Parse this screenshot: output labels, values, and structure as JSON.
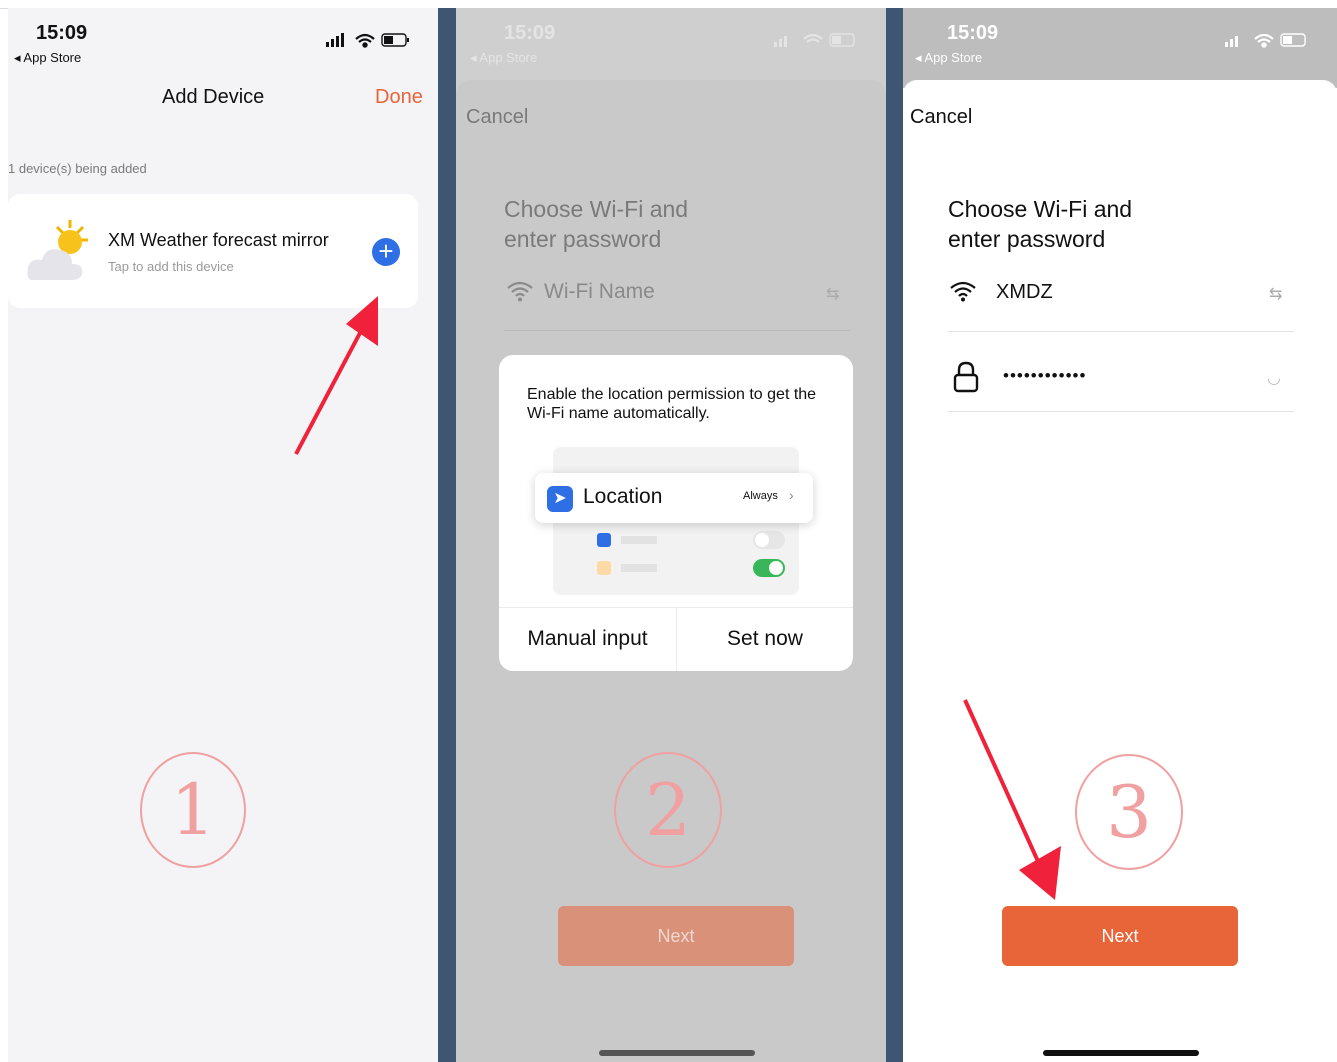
{
  "panel1": {
    "time": "15:09",
    "back_app": "App Store",
    "title": "Add Device",
    "done": "Done",
    "count_text": "1 device(s) being added",
    "device_name": "XM Weather forecast mirror",
    "device_hint": "Tap to add this device",
    "step": "1"
  },
  "panel2": {
    "time": "15:09",
    "back_app": "App Store",
    "cancel": "Cancel",
    "heading_line1": "Choose Wi-Fi and",
    "heading_line2": "enter password",
    "wifi_placeholder": "Wi-Fi Name",
    "dialog_message": "Enable the location permission to get the Wi-Fi name automatically.",
    "location_label": "Location",
    "location_value": "Always",
    "manual_input": "Manual input",
    "set_now": "Set now",
    "next": "Next",
    "step": "2"
  },
  "panel3": {
    "time": "15:09",
    "back_app": "App Store",
    "cancel": "Cancel",
    "heading_line1": "Choose Wi-Fi and",
    "heading_line2": "enter password",
    "wifi_name": "XMDZ",
    "password_mask": "••••••••••••",
    "next": "Next",
    "step": "3"
  },
  "colors": {
    "accent": "#e8653a",
    "blue": "#2f6fe6",
    "annotation_red": "#f0213a",
    "step_circle": "#f0a0a0"
  }
}
